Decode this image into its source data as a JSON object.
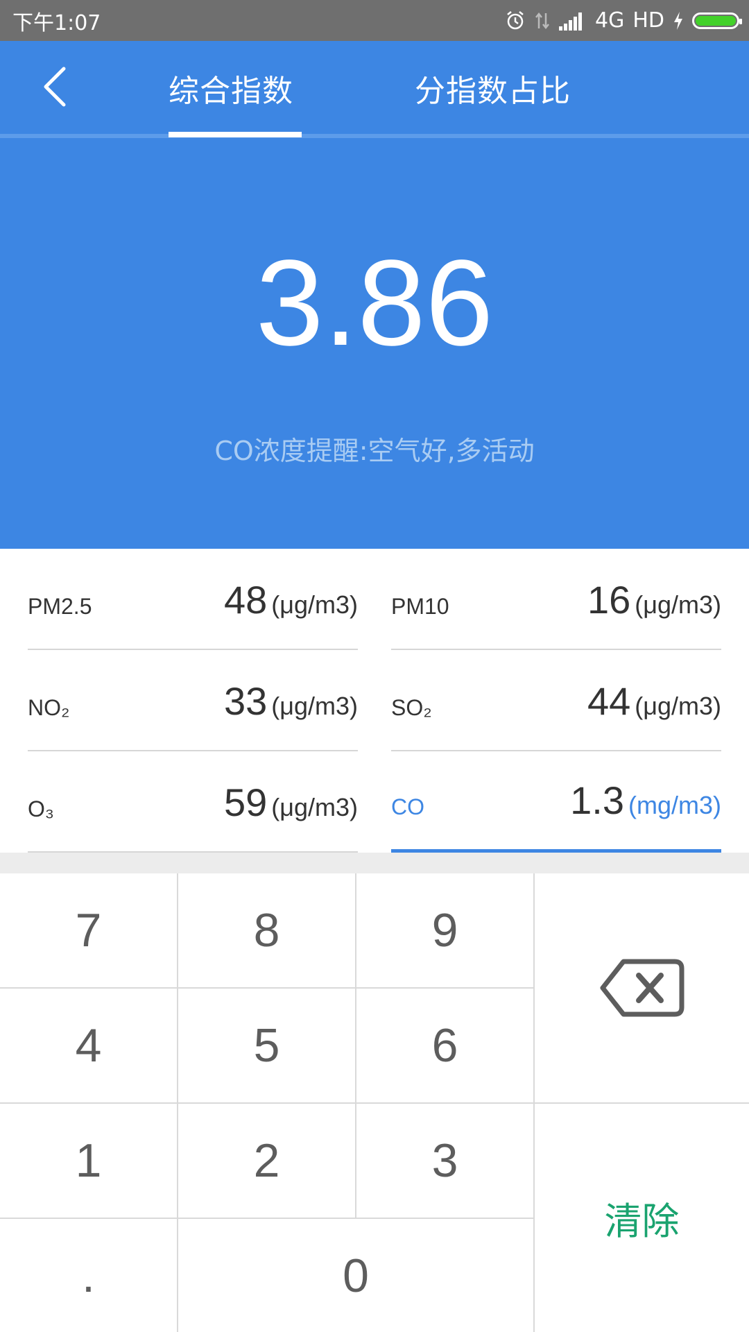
{
  "status_bar": {
    "time": "下午1:07",
    "network": "4G",
    "hd": "HD",
    "battery_level": 1.0,
    "battery_color": "#43d12a",
    "icons": [
      "alarm-icon",
      "data-arrows-icon",
      "signal-icon",
      "charging-icon",
      "battery-icon"
    ]
  },
  "header": {
    "back_icon": "chevron-left-icon",
    "tabs": [
      {
        "label": "综合指数",
        "active": true
      },
      {
        "label": "分指数占比",
        "active": false
      }
    ],
    "background_color": "#3d86e3"
  },
  "hero": {
    "value": "3.86",
    "hint": "CO浓度提醒:空气好,多活动"
  },
  "readings": [
    {
      "label": "PM2.5",
      "value": "48",
      "unit": "(μg/m3)",
      "active": false
    },
    {
      "label": "PM10",
      "value": "16",
      "unit": "(μg/m3)",
      "active": false
    },
    {
      "label": "NO₂",
      "value": "33",
      "unit": "(μg/m3)",
      "active": false
    },
    {
      "label": "SO₂",
      "value": "44",
      "unit": "(μg/m3)",
      "active": false
    },
    {
      "label": "O₃",
      "value": "59",
      "unit": "(μg/m3)",
      "active": false
    },
    {
      "label": "CO",
      "value": "1.3",
      "unit": "(mg/m3)",
      "active": true
    }
  ],
  "keypad": {
    "keys": [
      "7",
      "8",
      "9",
      "4",
      "5",
      "6",
      "1",
      "2",
      "3",
      ".",
      "0"
    ],
    "backspace_icon": "backspace-icon",
    "clear_label": "清除",
    "clear_color": "#1aa36f"
  }
}
